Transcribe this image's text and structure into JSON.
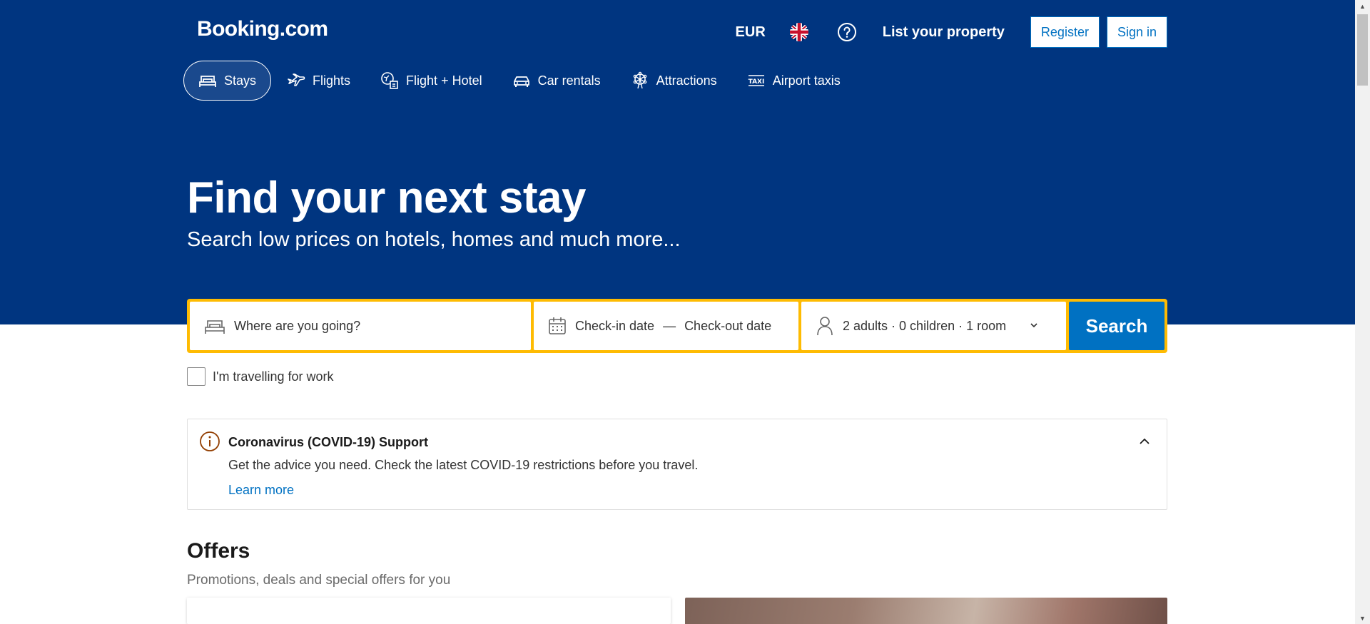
{
  "header": {
    "logo": "Booking.com",
    "currency": "EUR",
    "list_property": "List your property",
    "register": "Register",
    "sign_in": "Sign in"
  },
  "nav": {
    "items": [
      {
        "label": "Stays",
        "icon": "bed-icon"
      },
      {
        "label": "Flights",
        "icon": "plane-icon"
      },
      {
        "label": "Flight + Hotel",
        "icon": "flight-hotel-icon"
      },
      {
        "label": "Car rentals",
        "icon": "car-icon"
      },
      {
        "label": "Attractions",
        "icon": "ferris-wheel-icon"
      },
      {
        "label": "Airport taxis",
        "icon": "taxi-icon"
      }
    ]
  },
  "hero": {
    "title": "Find your next stay",
    "subtitle": "Search low prices on hotels, homes and much more..."
  },
  "search": {
    "destination_placeholder": "Where are you going?",
    "checkin": "Check-in date",
    "dash": "—",
    "checkout": "Check-out date",
    "guests": "2 adults · 0 children · 1 room",
    "button": "Search"
  },
  "work_travel": {
    "label": "I'm travelling for work",
    "checked": false
  },
  "covid": {
    "title": "Coronavirus (COVID-19) Support",
    "text": "Get the advice you need. Check the latest COVID-19 restrictions before you travel.",
    "link": "Learn more"
  },
  "offers": {
    "title": "Offers",
    "subtitle": "Promotions, deals and special offers for you"
  },
  "colors": {
    "brand_blue": "#003580",
    "action_blue": "#0071c2",
    "search_border": "#febb02"
  }
}
